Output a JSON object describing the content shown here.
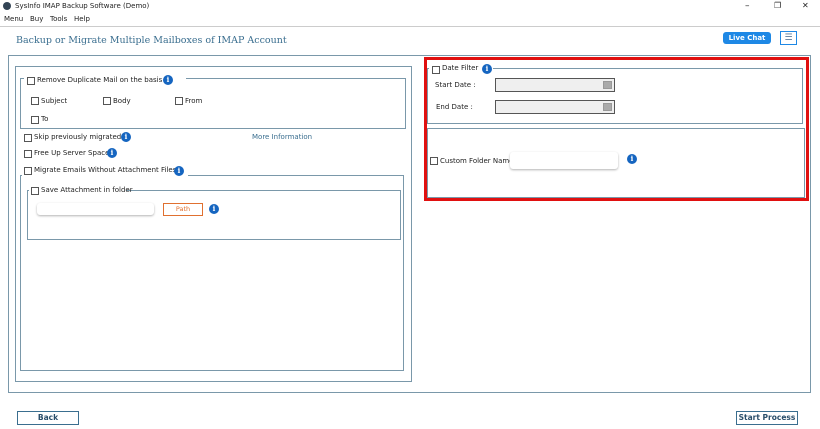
{
  "window": {
    "title": "SysInfo IMAP Backup Software (Demo)",
    "minimize": "–",
    "restore": "❐",
    "close": "✕"
  },
  "menu": [
    "Menu",
    "Buy",
    "Tools",
    "Help"
  ],
  "header": {
    "title": "Backup or Migrate Multiple Mailboxes of IMAP Account",
    "live_chat": "Live Chat",
    "hamburger": "☰"
  },
  "left": {
    "remove_duplicate": "Remove Duplicate Mail on the basis",
    "subject": "Subject",
    "body": "Body",
    "from": "From",
    "to": "To",
    "skip": "Skip previously migrated",
    "more_info": "More Information",
    "free_up": "Free Up Server Space",
    "migrate_without": "Migrate Emails Without Attachment Files",
    "save_attachment": "Save Attachment in folder",
    "path_button": "Path"
  },
  "right": {
    "date_filter": "Date Filter",
    "start_date": "Start Date :",
    "end_date": "End Date :",
    "custom_folder": "Custom Folder Name"
  },
  "footer": {
    "back": "Back",
    "start": "Start Process"
  },
  "colors": {
    "accent": "#1e88e5",
    "highlight": "#e01010",
    "border": "#7a98aa",
    "path": "#e07030"
  },
  "icons": {
    "info": "i"
  }
}
